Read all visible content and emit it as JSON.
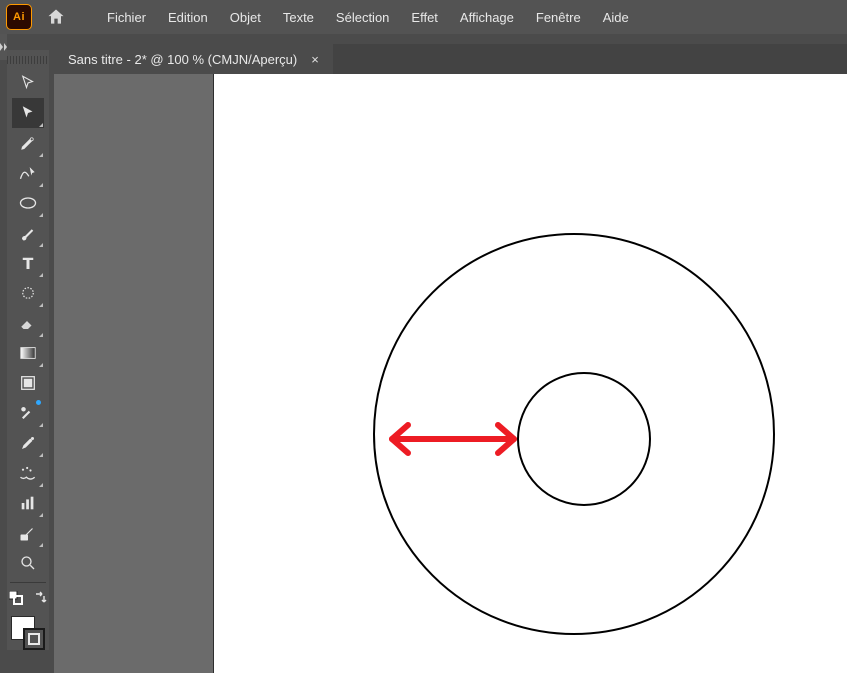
{
  "logo_text": "Ai",
  "menu": {
    "file": "Fichier",
    "edit": "Edition",
    "object": "Objet",
    "type": "Texte",
    "select": "Sélection",
    "effect": "Effet",
    "view": "Affichage",
    "window": "Fenêtre",
    "help": "Aide"
  },
  "documents": [
    {
      "title": "Sans titre - 2* @ 100 % (CMJN/Aperçu)",
      "close": "×"
    }
  ],
  "tools": [
    "selection",
    "direct-selection",
    "pen",
    "curvature-pen",
    "ellipse",
    "paintbrush",
    "type",
    "rotate",
    "eraser",
    "gradient",
    "artboard",
    "shape-builder",
    "eyedropper",
    "symbol-sprayer",
    "graph",
    "slice",
    "zoom"
  ],
  "swatches": {
    "fill": "#ffffff",
    "stroke": "#000000"
  },
  "annotation": {
    "color": "#ED1C24"
  }
}
